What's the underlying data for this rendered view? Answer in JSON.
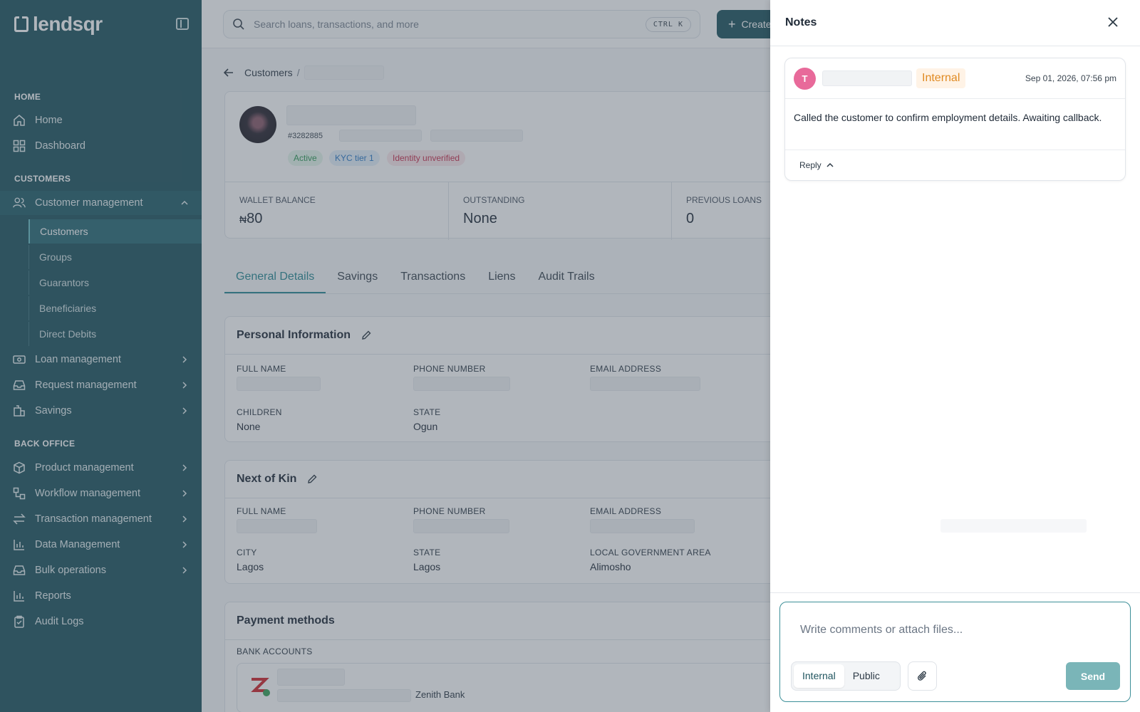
{
  "brand": {
    "logo_text": "lendsqr"
  },
  "sidebar": {
    "sections": {
      "home": "HOME",
      "customers": "CUSTOMERS",
      "back_office": "BACK OFFICE"
    },
    "items": {
      "home": "Home",
      "dashboard": "Dashboard",
      "customer_management": "Customer management",
      "loan_management": "Loan management",
      "request_management": "Request management",
      "savings": "Savings",
      "product_management": "Product management",
      "workflow_management": "Workflow management",
      "transaction_management": "Transaction management",
      "data_management": "Data Management",
      "bulk_operations": "Bulk operations",
      "reports": "Reports",
      "audit_logs": "Audit Logs"
    },
    "customer_sub": {
      "customers": "Customers",
      "groups": "Groups",
      "guarantors": "Guarantors",
      "beneficiaries": "Beneficiaries",
      "direct_debits": "Direct Debits"
    }
  },
  "topbar": {
    "search_placeholder": "Search loans, transactions, and more",
    "shortcut": "CTRL  K",
    "create_label": "Create"
  },
  "breadcrumb": {
    "parent": "Customers",
    "separator": "/"
  },
  "profile": {
    "customer_id": "#3282885",
    "badges": {
      "status": "Active",
      "kyc": "KYC tier 1",
      "identity": "Identity unverified"
    },
    "stats": {
      "wallet_label": "WALLET BALANCE",
      "wallet_currency": "₦",
      "wallet_value": "80",
      "outstanding_label": "OUTSTANDING",
      "outstanding_value": "None",
      "previous_label": "PREVIOUS LOANS",
      "previous_value": "0"
    }
  },
  "tabs": [
    "General Details",
    "Savings",
    "Transactions",
    "Liens",
    "Audit Trails"
  ],
  "personal_info": {
    "title": "Personal Information",
    "full_name_label": "FULL NAME",
    "phone_label": "PHONE NUMBER",
    "email_label": "EMAIL ADDRESS",
    "children_label": "CHILDREN",
    "children_value": "None",
    "state_label": "STATE",
    "state_value": "Ogun"
  },
  "next_of_kin": {
    "title": "Next of Kin",
    "full_name_label": "FULL NAME",
    "phone_label": "PHONE NUMBER",
    "email_label": "EMAIL ADDRESS",
    "city_label": "CITY",
    "city_value": "Lagos",
    "state_label": "STATE",
    "state_value": "Lagos",
    "lga_label": "LOCAL GOVERNMENT AREA",
    "lga_value": "Alimosho"
  },
  "payment_methods": {
    "title": "Payment methods",
    "bank_accounts_label": "BANK ACCOUNTS",
    "bank_name": "Zenith Bank"
  },
  "notes": {
    "title": "Notes",
    "note": {
      "avatar_initial": "T",
      "visibility": "Internal",
      "date": "Sep 01, 2026, 07:56 pm",
      "body": "Called the customer to confirm employment details. Awaiting callback.",
      "reply_label": "Reply"
    },
    "composer": {
      "placeholder": "Write comments or attach files...",
      "internal_label": "Internal",
      "public_label": "Public",
      "send_label": "Send"
    }
  },
  "colors": {
    "sidebar": "#20555f",
    "accent": "#2a8a94",
    "send": "#7ab5b8",
    "internal_tag": "#e08a22"
  }
}
